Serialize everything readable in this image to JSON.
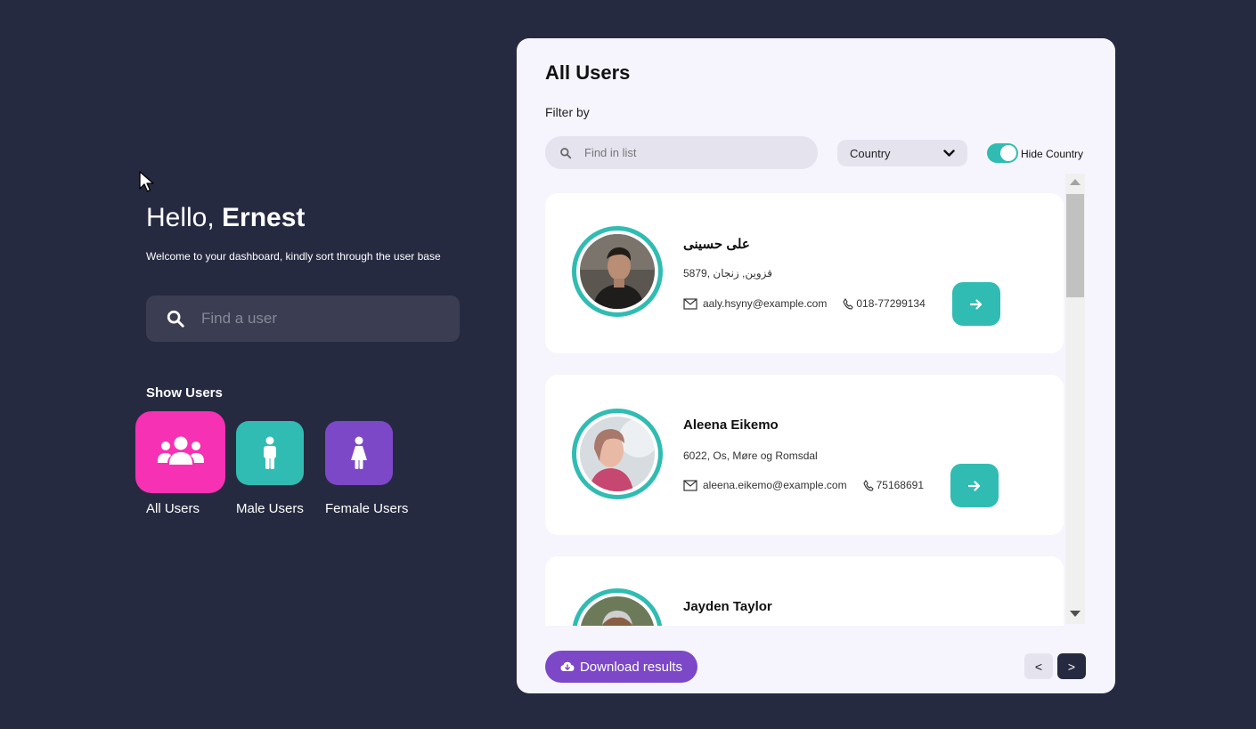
{
  "greeting": {
    "hello": "Hello, ",
    "name": "Ernest"
  },
  "welcome_text": "Welcome to your dashboard, kindly sort through the user base",
  "search": {
    "placeholder": "Find a user"
  },
  "show_users": {
    "title": "Show Users",
    "categories": [
      {
        "label": "All Users",
        "icon": "users-group-icon",
        "color": "#f631b4"
      },
      {
        "label": "Male Users",
        "icon": "male-icon",
        "color": "#30bcb2"
      },
      {
        "label": "Female Users",
        "icon": "female-icon",
        "color": "#7c48c8"
      }
    ]
  },
  "panel": {
    "title": "All Users",
    "filter_label": "Filter by",
    "find_placeholder": "Find in list",
    "country_select": "Country",
    "toggle_label": "Hide Country",
    "toggle_on": true
  },
  "users": [
    {
      "name": "علی حسینی",
      "address": "5879, قزوین, زنجان",
      "email": "aaly.hsyny@example.com",
      "phone": "018-77299134"
    },
    {
      "name": "Aleena Eikemo",
      "address": "6022, Os, Møre og Romsdal",
      "email": "aleena.eikemo@example.com",
      "phone": "75168691"
    },
    {
      "name": "Jayden Taylor",
      "address": "",
      "email": "",
      "phone": ""
    }
  ],
  "footer": {
    "download_label": "Download results",
    "prev": "<",
    "next": ">"
  },
  "colors": {
    "background": "#262a41",
    "accent_teal": "#30bcb2",
    "accent_pink": "#f631b4",
    "accent_purple": "#7c48c8",
    "panel": "#f6f5fe"
  }
}
